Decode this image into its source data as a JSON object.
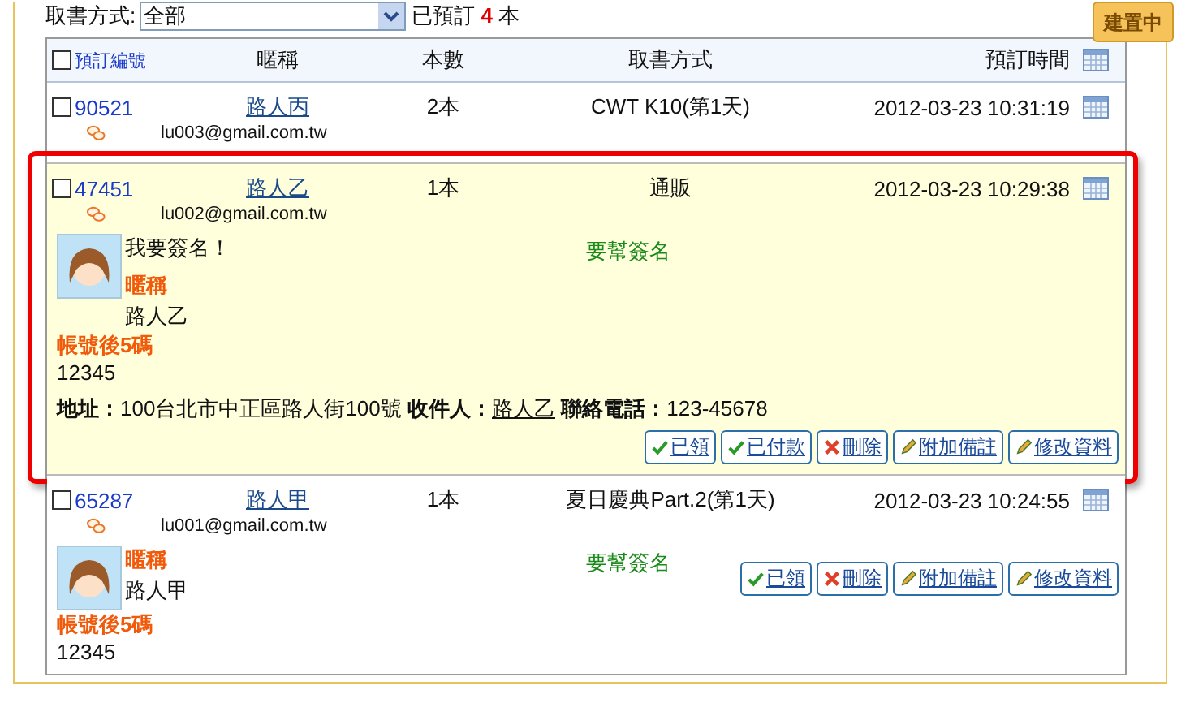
{
  "filter": {
    "label": "取書方式:",
    "value": "全部",
    "summary_prefix": "已預訂",
    "count": "4",
    "summary_suffix": "本"
  },
  "status_button": "建置中",
  "table": {
    "select_all_checked": false,
    "columns": [
      "預訂編號",
      "暱稱",
      "本數",
      "取書方式",
      "預訂時間"
    ],
    "rows": [
      {
        "checked": false,
        "id": "90521",
        "nickname": "路人丙",
        "count": "2本",
        "method": "CWT K10(第1天)",
        "time": "2012-03-23 10:31:19",
        "email": "lu003@gmail.com.tw",
        "highlighted": false
      },
      {
        "checked": false,
        "id": "47451",
        "nickname": "路人乙",
        "count": "1本",
        "method": "通販",
        "time": "2012-03-23 10:29:38",
        "email": "lu002@gmail.com.tw",
        "highlighted": true,
        "details": {
          "message": "我要簽名！",
          "request": "要幫簽名",
          "nickname_label": "暱稱",
          "nickname": "路人乙",
          "account_label": "帳號後5碼",
          "account": "12345",
          "address": {
            "address_label": "地址：",
            "address": "100台北市中正區路人街100號",
            "recipient_label": "收件人：",
            "recipient": "路人乙",
            "phone_label": "聯絡電話：",
            "phone": "123-45678"
          },
          "actions": [
            {
              "label": "已領",
              "kind": "check"
            },
            {
              "label": "已付款",
              "kind": "check"
            },
            {
              "label": "刪除",
              "kind": "delete"
            },
            {
              "label": "附加備註",
              "kind": "edit"
            },
            {
              "label": "修改資料",
              "kind": "edit"
            }
          ]
        }
      },
      {
        "checked": false,
        "id": "65287",
        "nickname": "路人甲",
        "count": "1本",
        "method": "夏日慶典Part.2(第1天)",
        "time": "2012-03-23 10:24:55",
        "email": "lu001@gmail.com.tw",
        "highlighted": false,
        "details": {
          "request": "要幫簽名",
          "nickname_label": "暱稱",
          "nickname": "路人甲",
          "account_label": "帳號後5碼",
          "account": "12345",
          "actions": [
            {
              "label": "已領",
              "kind": "check"
            },
            {
              "label": "刪除",
              "kind": "delete"
            },
            {
              "label": "附加備註",
              "kind": "edit"
            },
            {
              "label": "修改資料",
              "kind": "edit"
            }
          ]
        }
      }
    ]
  }
}
